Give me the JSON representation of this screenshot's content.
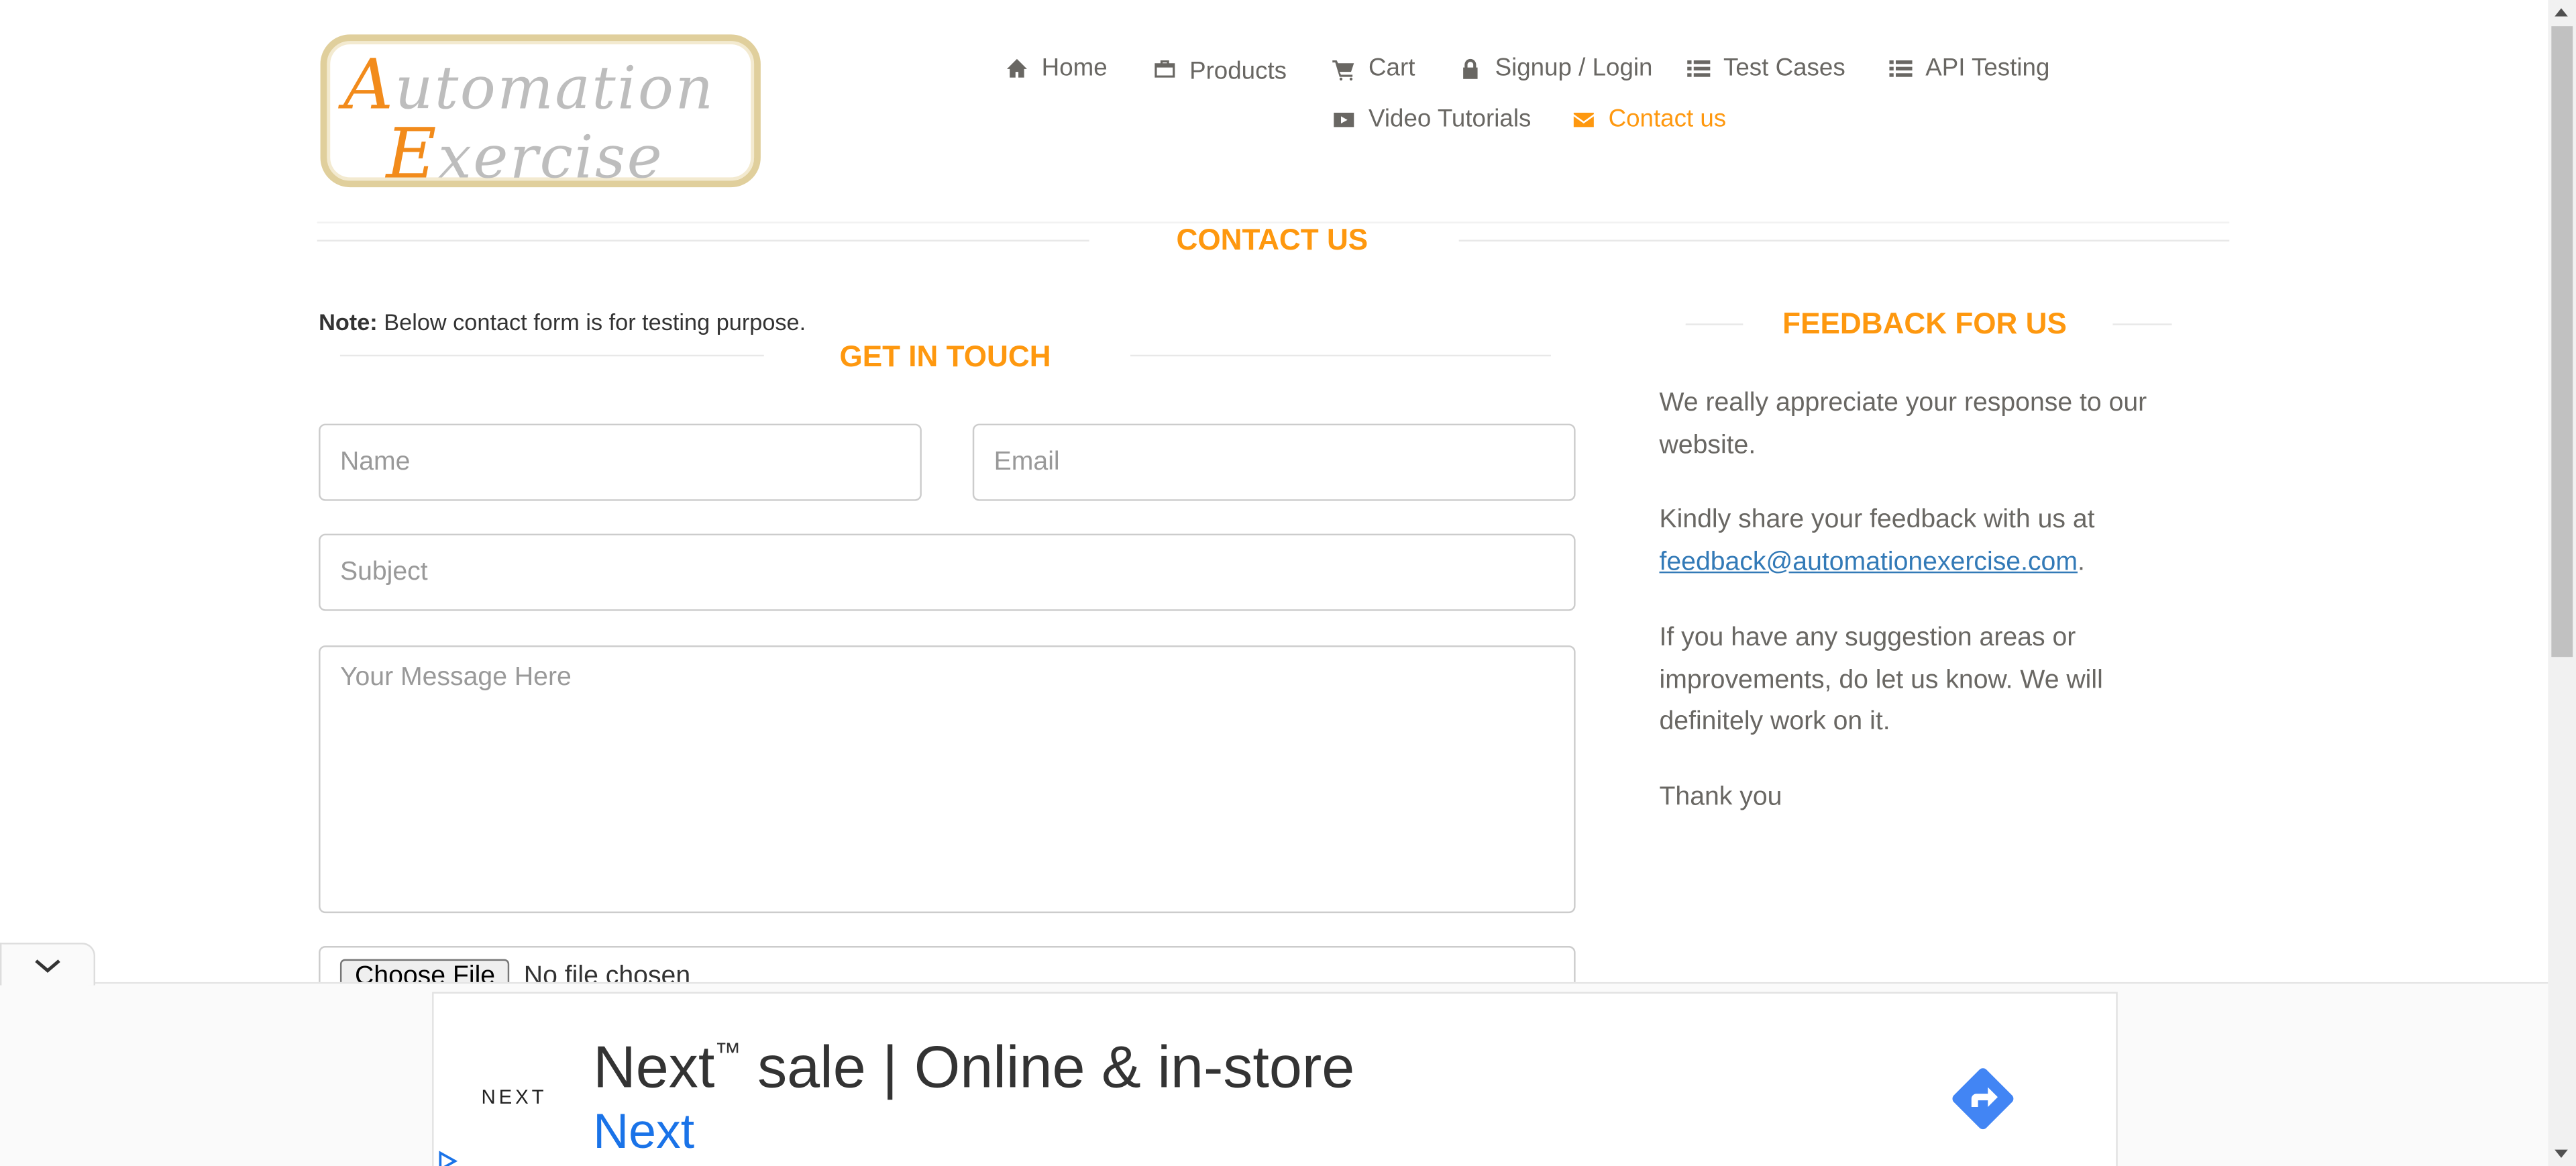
{
  "logo": {
    "line1_cap": "A",
    "line1_rest": "utomation",
    "line2_cap": "E",
    "line2_rest": "xercise"
  },
  "nav": {
    "items": [
      {
        "label": "Home",
        "icon": "home-icon"
      },
      {
        "label": "Products",
        "icon": "briefcase-icon"
      },
      {
        "label": "Cart",
        "icon": "cart-icon"
      },
      {
        "label": "Signup / Login",
        "icon": "lock-icon"
      },
      {
        "label": "Test Cases",
        "icon": "list-icon"
      },
      {
        "label": "API Testing",
        "icon": "list-icon"
      },
      {
        "label": "Video Tutorials",
        "icon": "youtube-icon"
      },
      {
        "label": "Contact us",
        "icon": "envelope-icon",
        "active": true
      }
    ]
  },
  "page": {
    "title": "CONTACT US",
    "note_label": "Note:",
    "note_text": " Below contact form is for testing purpose."
  },
  "form": {
    "title": "GET IN TOUCH",
    "name_placeholder": "Name",
    "email_placeholder": "Email",
    "subject_placeholder": "Subject",
    "message_placeholder": "Your Message Here",
    "file_button": "Choose File",
    "file_status": "No file chosen"
  },
  "feedback": {
    "title": "FEEDBACK FOR US",
    "p1": "We really appreciate your response to our website.",
    "p2_text": "Kindly share your feedback with us at ",
    "p2_link": "feedback@automationexercise.com",
    "p2_end": ".",
    "p3": "If you have any suggestion areas or improvements, do let us know. We will definitely work on it.",
    "p4": "Thank you"
  },
  "ad": {
    "brand": "NEXT",
    "headline": "Next",
    "headline_tm": "™",
    "headline_rest": " sale | Online & in-store",
    "subline": "Next",
    "cta_color": "#4285f4"
  },
  "colors": {
    "accent": "#fe980f",
    "text": "#696763",
    "link": "#337ab7"
  }
}
